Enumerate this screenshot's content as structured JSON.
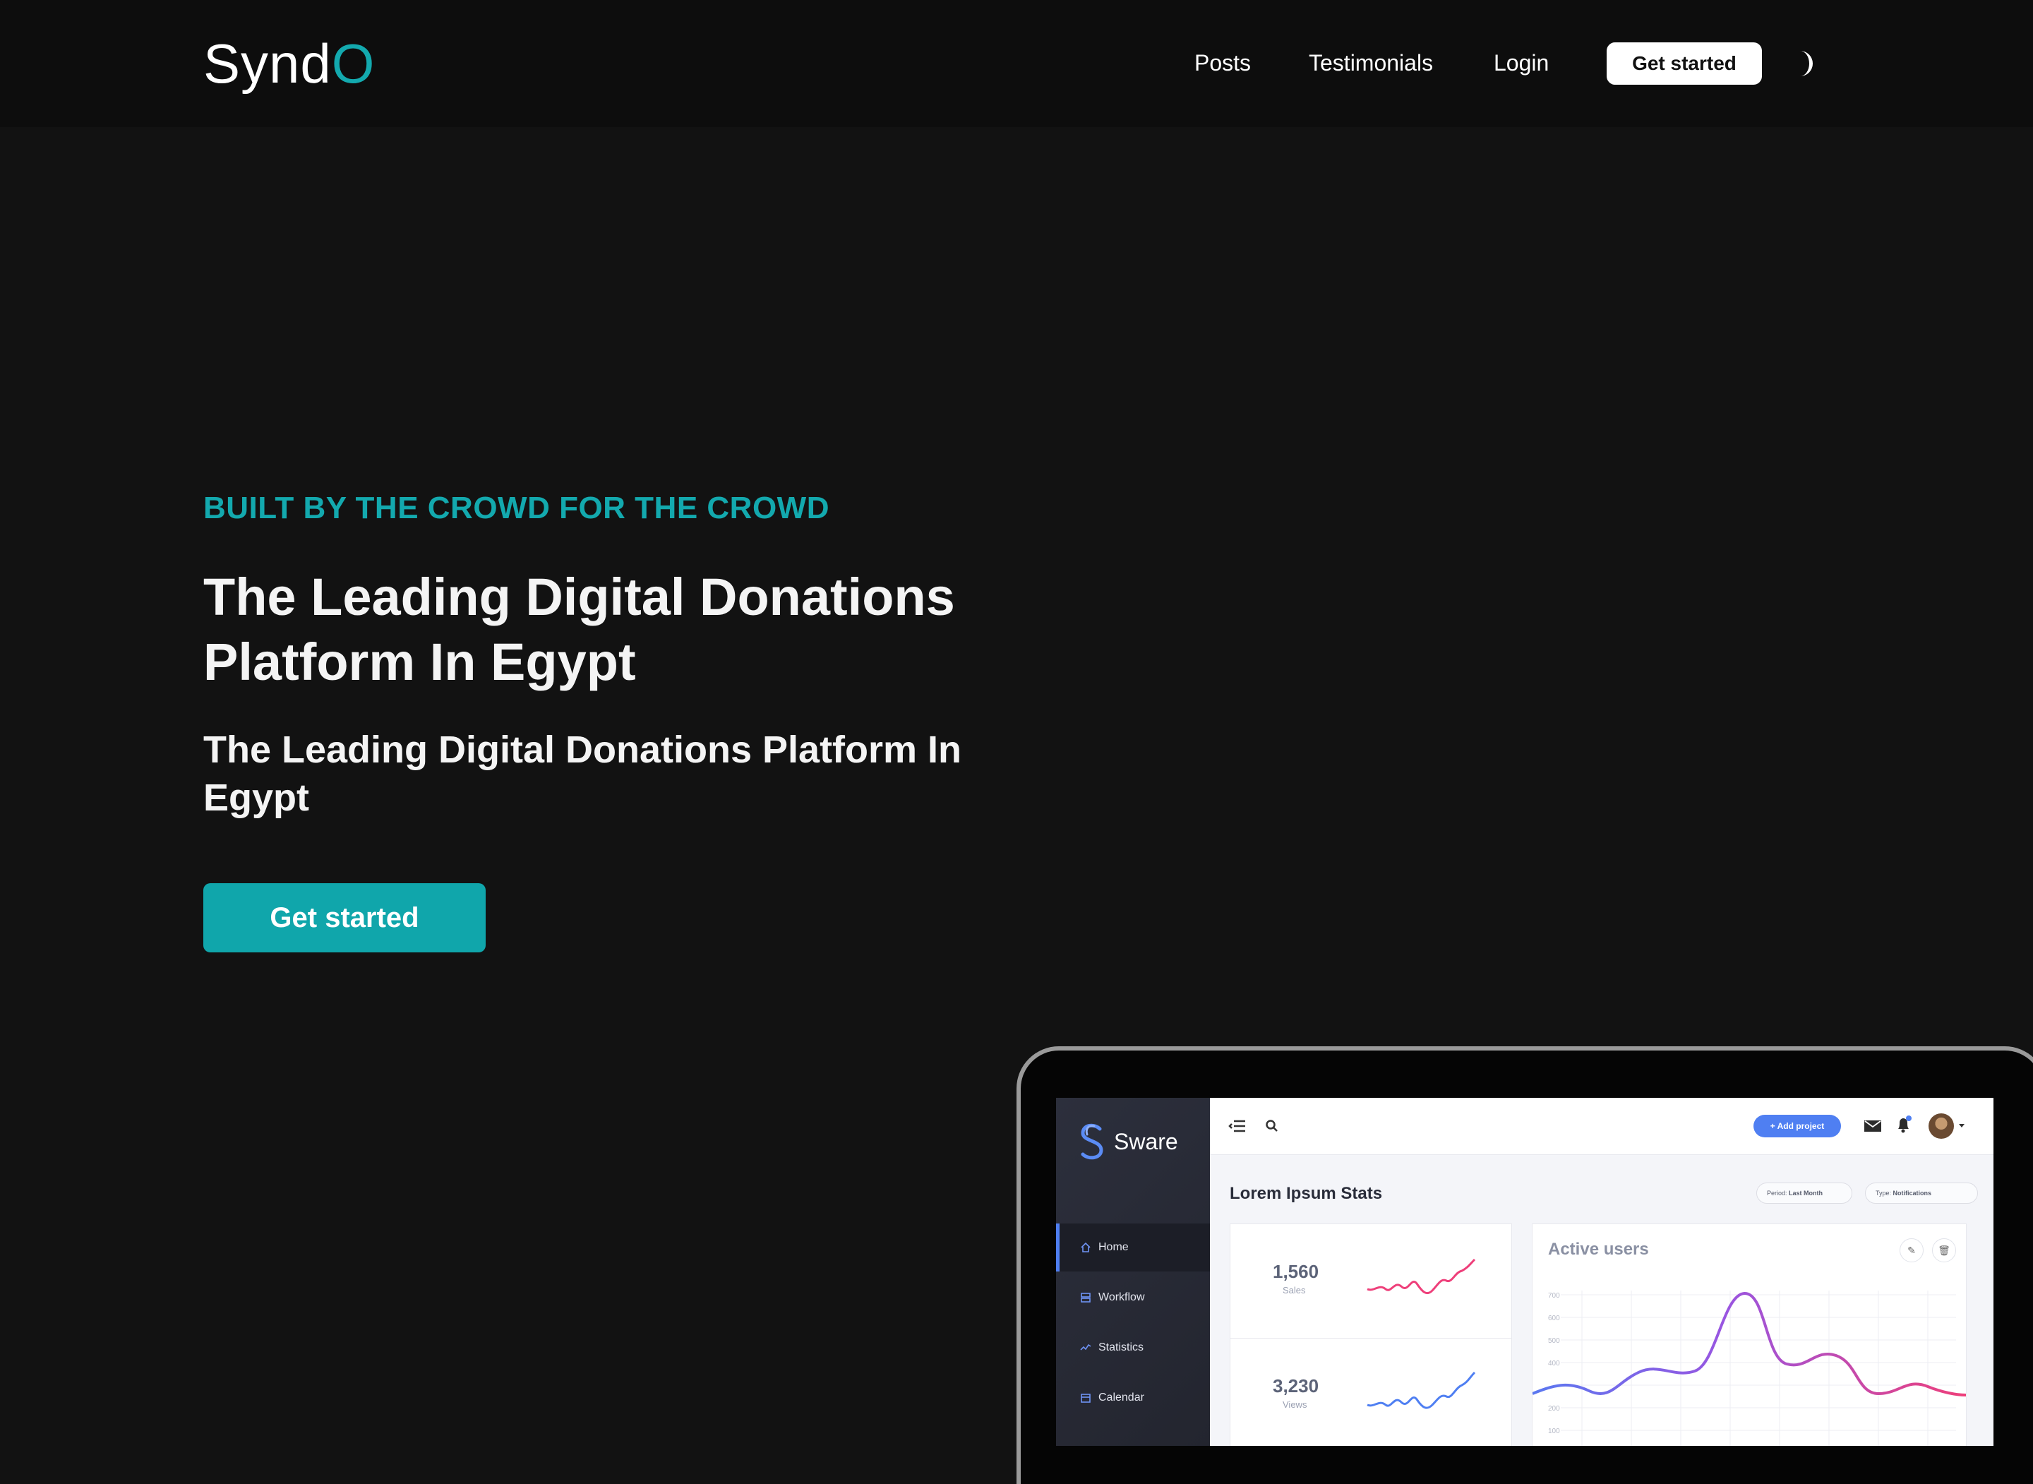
{
  "nav": {
    "logo_main": "Synd",
    "logo_accent": "O",
    "links": [
      "Posts",
      "Testimonials",
      "Login"
    ],
    "cta": "Get started",
    "theme_toggle_icon": "moon-icon"
  },
  "hero": {
    "tagline": "BUILT BY THE CROWD FOR THE CROWD",
    "title": "The Leading Digital Donations Platform In Egypt",
    "subtitle": "The Leading Digital Donations Platform In Egypt",
    "cta": "Get started"
  },
  "colors": {
    "accent": "#13a9ae",
    "background": "#121212",
    "navbar": "#0d0d0d"
  },
  "mockup": {
    "brand": "Sware",
    "sidebar": [
      {
        "label": "Home",
        "icon": "home-icon",
        "active": true
      },
      {
        "label": "Workflow",
        "icon": "workflow-icon",
        "active": false
      },
      {
        "label": "Statistics",
        "icon": "statistics-icon",
        "active": false
      },
      {
        "label": "Calendar",
        "icon": "calendar-icon",
        "active": false
      }
    ],
    "add_project": "+ Add project",
    "heading": "Lorem Ipsum Stats",
    "filters": [
      {
        "label": "Period:",
        "value": "Last Month"
      },
      {
        "label": "Type:",
        "value": "Notifications"
      }
    ],
    "stats": [
      {
        "value": "1,560",
        "label": "Sales"
      },
      {
        "value": "3,230",
        "label": "Views"
      }
    ],
    "chart": {
      "title": "Active users",
      "ticks": [
        "700",
        "600",
        "500",
        "400",
        "300",
        "200",
        "100"
      ]
    }
  }
}
